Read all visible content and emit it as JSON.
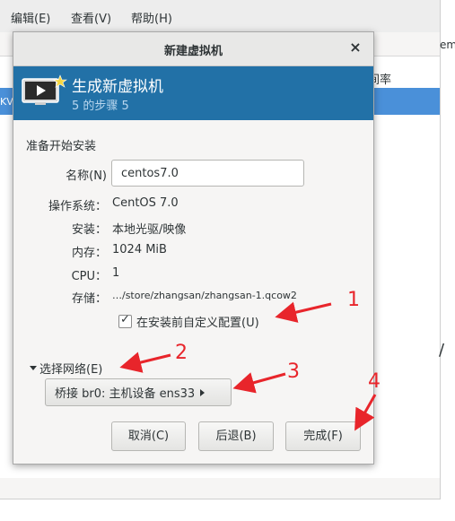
{
  "background_app": {
    "menu": [
      "编辑(E)",
      "查看(V)",
      "帮助(H)"
    ],
    "column_header_fragment": "间率",
    "row_fragment": "KV",
    "right_edge_fragment": "emd",
    "right_edge_fragment2": "/"
  },
  "dialog": {
    "title": "新建虚拟机",
    "close_glyph": "×",
    "banner": {
      "title": "生成新虚拟机",
      "step": "5 的步骤 5"
    },
    "section_heading": "准备开始安装",
    "name": {
      "label": "名称(N)",
      "value": "centos7.0"
    },
    "fields": {
      "os_label": "操作系统：",
      "os_value": "CentOS 7.0",
      "install_label": "安装：",
      "install_value": "本地光驱/映像",
      "memory_label": "内存：",
      "memory_value": "1024 MiB",
      "cpu_label": "CPU：",
      "cpu_value": "1",
      "storage_label": "存储：",
      "storage_value": "…/store/zhangsan/zhangsan-1.qcow2"
    },
    "customize_checkbox": {
      "label": "在安装前自定义配置(U)",
      "checked": true
    },
    "network_expander": {
      "label": "选择网络(E)",
      "expanded": true
    },
    "network_button": {
      "label": "桥接 br0: 主机设备 ens33"
    },
    "buttons": {
      "cancel": "取消(C)",
      "back": "后退(B)",
      "finish": "完成(F)"
    }
  },
  "annotations": [
    "1",
    "2",
    "3",
    "4"
  ],
  "colors": {
    "banner": "#2271a7",
    "selection": "#4a90d9",
    "annotation": "#e8252b"
  }
}
